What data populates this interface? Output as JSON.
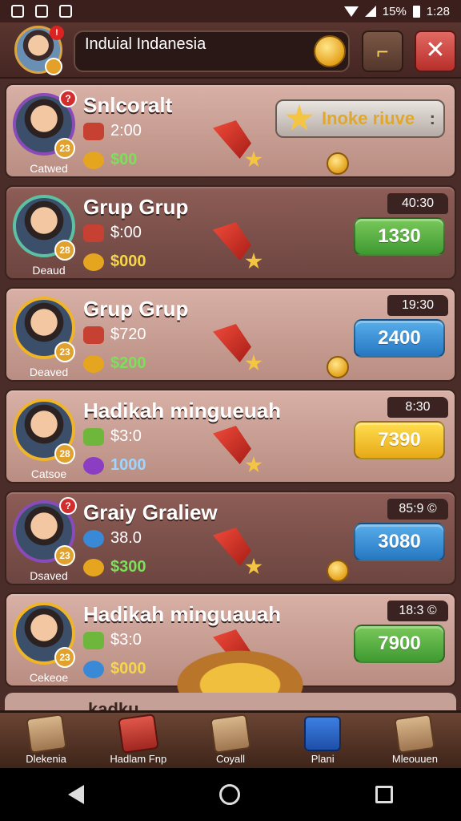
{
  "status": {
    "battery": "15%",
    "time": "1:28"
  },
  "header": {
    "title": "Induial Indanesia",
    "level": "",
    "notif": "!"
  },
  "invite": {
    "label": "Inoke riuve",
    "more": ":"
  },
  "cards": [
    {
      "name": "Snlcoralt",
      "caption": "Catwed",
      "level": "23",
      "notif": "?",
      "stat1": "2:00",
      "stat2": "$00",
      "timer": "",
      "pill": "",
      "pill_color": "",
      "theme": "light",
      "ring": "purple"
    },
    {
      "name": "Grup Grup",
      "caption": "Deaud",
      "level": "28",
      "notif": "",
      "stat1": "$:00",
      "stat2": "$000",
      "timer": "40:30",
      "pill": "1330",
      "pill_color": "green",
      "theme": "dark",
      "ring": "teal"
    },
    {
      "name": "Grup Grup",
      "caption": "Deaved",
      "level": "23",
      "notif": "",
      "stat1": "$720",
      "stat2": "$200",
      "timer": "19:30",
      "pill": "2400",
      "pill_color": "blue",
      "theme": "light",
      "ring": "gold"
    },
    {
      "name": "Hadikah mingueuah",
      "caption": "Catsoe",
      "level": "28",
      "notif": "",
      "stat1": "$3:0",
      "stat2": "1000",
      "timer": "8:30",
      "pill": "7390",
      "pill_color": "yellow",
      "theme": "light",
      "ring": "gold"
    },
    {
      "name": "Graiy Graliew",
      "caption": "Dsaved",
      "level": "23",
      "notif": "?",
      "stat1": "38.0",
      "stat2": "$300",
      "timer": "85:9 ©",
      "pill": "3080",
      "pill_color": "blue",
      "theme": "dark",
      "ring": "purple"
    },
    {
      "name": "Hadikah minguauah",
      "caption": "Cekeoe",
      "level": "23",
      "notif": "",
      "stat1": "$3:0",
      "stat2": "$000",
      "timer": "18:3 ©",
      "pill": "7900",
      "pill_color": "green",
      "theme": "light",
      "ring": "gold"
    }
  ],
  "peek": {
    "label": "kadku"
  },
  "nav": [
    {
      "label": "Dlekenia",
      "icon": "scroll-icon"
    },
    {
      "label": "Hadlam Fnp",
      "icon": "card-icon"
    },
    {
      "label": "Coyall",
      "icon": "parchment-icon"
    },
    {
      "label": "Plani",
      "icon": "gift-box-icon"
    },
    {
      "label": "Mleouuen",
      "icon": "map-icon"
    }
  ]
}
